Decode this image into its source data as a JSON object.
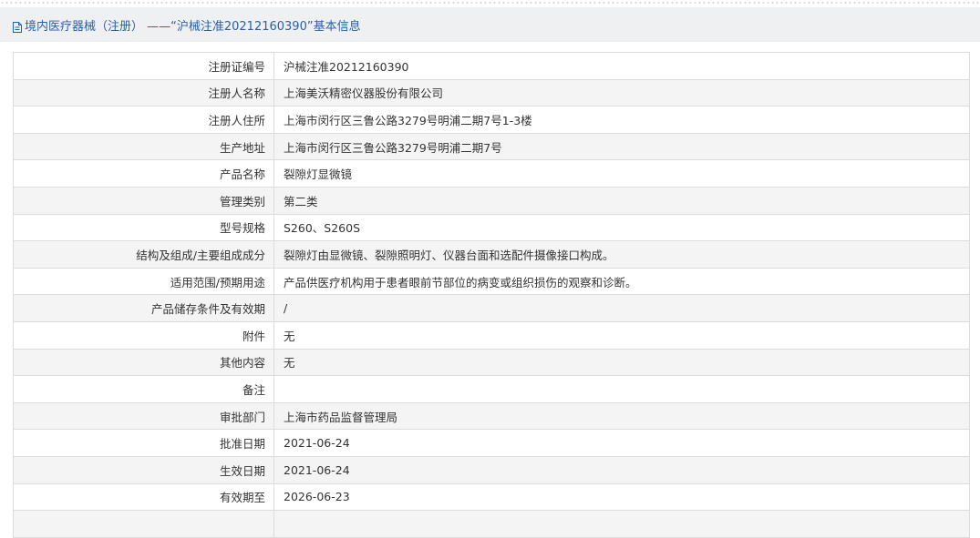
{
  "header": {
    "icon": "document-icon",
    "title": "境内医疗器械（注册） ——“沪械注准20212160390”基本信息"
  },
  "rows": [
    {
      "label": "注册证编号",
      "value": "沪械注准20212160390"
    },
    {
      "label": "注册人名称",
      "value": "上海美沃精密仪器股份有限公司"
    },
    {
      "label": "注册人住所",
      "value": "上海市闵行区三鲁公路3279号明浦二期7号1-3楼"
    },
    {
      "label": "生产地址",
      "value": "上海市闵行区三鲁公路3279号明浦二期7号"
    },
    {
      "label": "产品名称",
      "value": "裂隙灯显微镜"
    },
    {
      "label": "管理类别",
      "value": "第二类"
    },
    {
      "label": "型号规格",
      "value": "S260、S260S"
    },
    {
      "label": "结构及组成/主要组成成分",
      "value": "裂隙灯由显微镜、裂隙照明灯、仪器台面和选配件摄像接口构成。"
    },
    {
      "label": "适用范围/预期用途",
      "value": "产品供医疗机构用于患者眼前节部位的病变或组织损伤的观察和诊断。"
    },
    {
      "label": "产品储存条件及有效期",
      "value": "/"
    },
    {
      "label": "附件",
      "value": "无"
    },
    {
      "label": "其他内容",
      "value": "无"
    },
    {
      "label": "备注",
      "value": ""
    },
    {
      "label": "审批部门",
      "value": "上海市药品监督管理局"
    },
    {
      "label": "批准日期",
      "value": "2021-06-24"
    },
    {
      "label": "生效日期",
      "value": "2021-06-24"
    },
    {
      "label": "有效期至",
      "value": "2026-06-23"
    },
    {
      "label": "",
      "value": ""
    }
  ]
}
